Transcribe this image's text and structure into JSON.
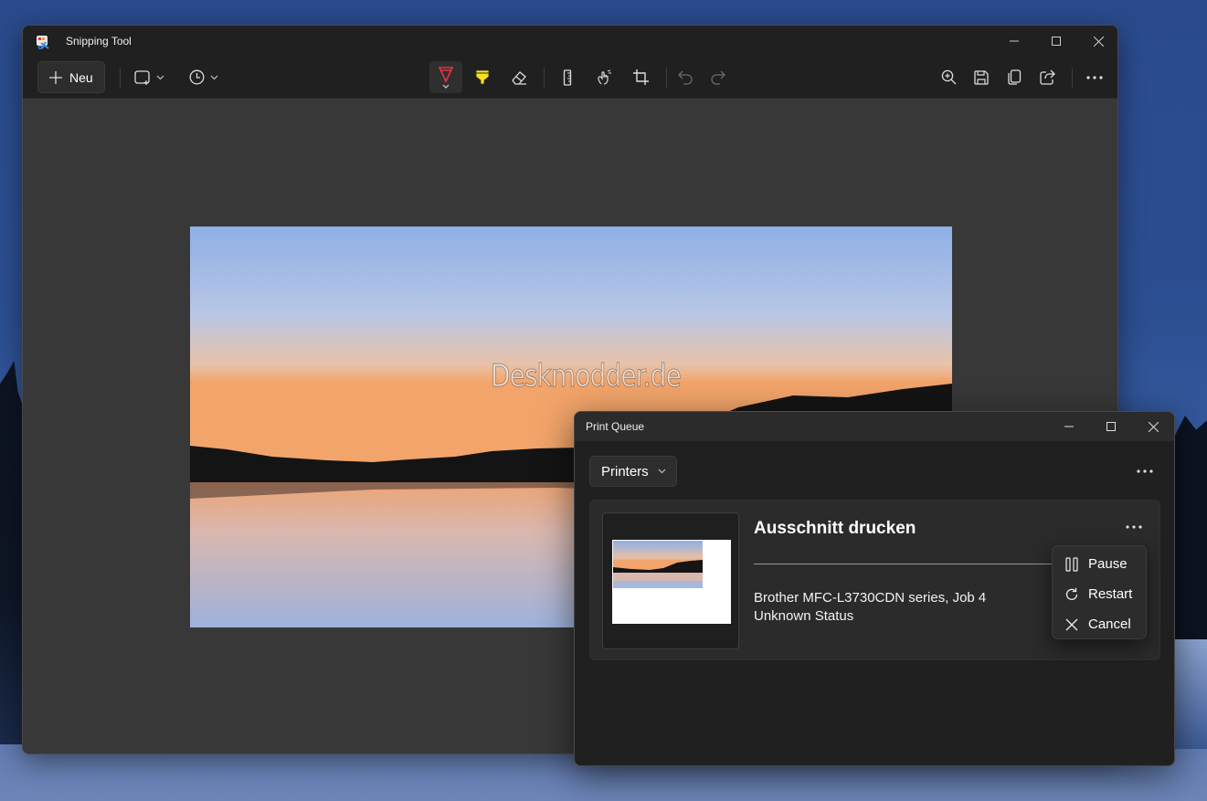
{
  "snipping_tool": {
    "title": "Snipping Tool",
    "new_label": "Neu",
    "toolbar_icons": [
      "new-icon",
      "snip-mode-icon",
      "delay-icon",
      "ballpoint-pen-icon",
      "highlighter-icon",
      "eraser-icon",
      "ruler-icon",
      "touch-writing-icon",
      "crop-icon",
      "undo-icon",
      "redo-icon",
      "zoom-icon",
      "save-icon",
      "copy-icon",
      "share-icon",
      "more-icon"
    ],
    "pen_color": "#e8323c",
    "highlighter_color": "#f4e21c",
    "watermark": "Deskmodder.de"
  },
  "print_queue": {
    "title": "Print Queue",
    "printers_label": "Printers",
    "job": {
      "name": "Ausschnitt drucken",
      "printer": "Brother MFC-L3730CDN series, Job 4",
      "status": "Unknown Status"
    },
    "context_menu": [
      {
        "label": "Pause",
        "icon": "pause-icon"
      },
      {
        "label": "Restart",
        "icon": "restart-icon"
      },
      {
        "label": "Cancel",
        "icon": "cancel-icon"
      }
    ]
  }
}
